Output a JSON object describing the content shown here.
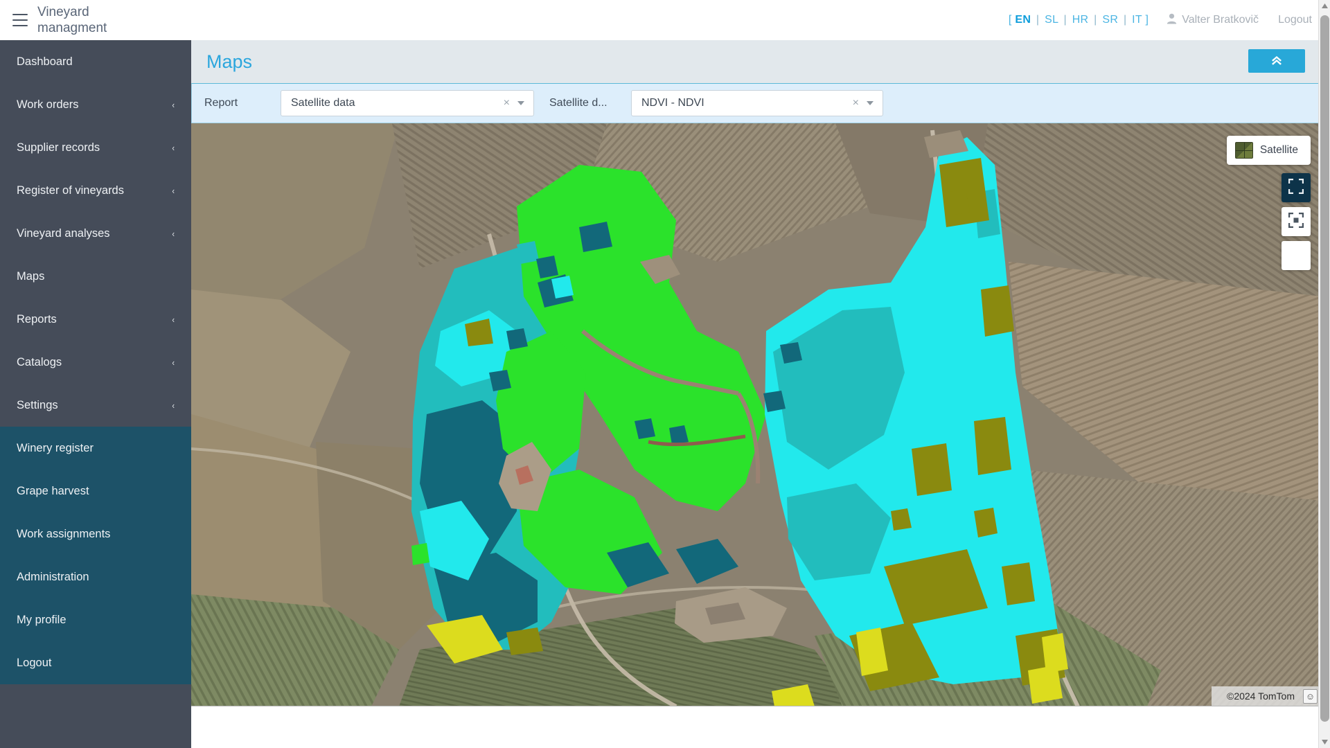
{
  "topbar": {
    "brand_line1": "Vineyard",
    "brand_line2": "managment",
    "clipped_title": "nt",
    "menu_icon": "hamburger-icon",
    "languages": [
      {
        "code": "EN",
        "active": true
      },
      {
        "code": "SL",
        "active": false
      },
      {
        "code": "HR",
        "active": false
      },
      {
        "code": "SR",
        "active": false
      },
      {
        "code": "IT",
        "active": false
      }
    ],
    "bracket_open": "[",
    "bracket_close": "]",
    "separator": "|",
    "user_name": "Valter Bratkovič",
    "logout_label": "Logout"
  },
  "sidebar": {
    "items": [
      {
        "label": "Dashboard",
        "chevron": ""
      },
      {
        "label": "Work orders",
        "chevron": "‹"
      },
      {
        "label": "Supplier records",
        "chevron": "‹"
      },
      {
        "label": "Register of vineyards",
        "chevron": "‹"
      },
      {
        "label": "Vineyard analyses",
        "chevron": "‹"
      },
      {
        "label": "Maps",
        "chevron": ""
      },
      {
        "label": "Reports",
        "chevron": "‹"
      },
      {
        "label": "Catalogs",
        "chevron": "‹"
      },
      {
        "label": "Settings",
        "chevron": "‹"
      }
    ],
    "submenu_items": [
      {
        "label": "Winery register"
      },
      {
        "label": "Grape harvest"
      },
      {
        "label": "Work assignments"
      },
      {
        "label": "Administration"
      },
      {
        "label": "My profile"
      },
      {
        "label": "Logout"
      }
    ]
  },
  "page": {
    "title": "Maps",
    "collapse_button_icon": "chevron-double-up-icon"
  },
  "filters": {
    "report": {
      "label": "Report",
      "value": "Satellite data",
      "clear_icon": "×"
    },
    "satellite_data": {
      "label": "Satellite d...",
      "value": "NDVI - NDVI",
      "clear_icon": "×"
    }
  },
  "map": {
    "layer_button_label": "Satellite",
    "attribution": "©2024 TomTom",
    "feedback_icon": "☺",
    "controls": [
      {
        "name": "fullscreen-select-icon",
        "active": true
      },
      {
        "name": "fit-bounds-icon",
        "active": false
      },
      {
        "name": "blank-control-icon",
        "active": false
      }
    ],
    "ndvi_colors": {
      "high": "#2BE22B",
      "cyan": "#22E9EC",
      "teal": "#22BDBD",
      "dark_teal": "#12687A",
      "olive": "#8A8A0F",
      "yellow": "#DCDC1E"
    }
  },
  "theme": {
    "sidebar_bg": "#454c59",
    "submenu_bg": "#1d5268",
    "accent": "#28a8d8",
    "page_head_bg": "#e2e8ec",
    "filter_bar_bg": "#ddeefb"
  }
}
